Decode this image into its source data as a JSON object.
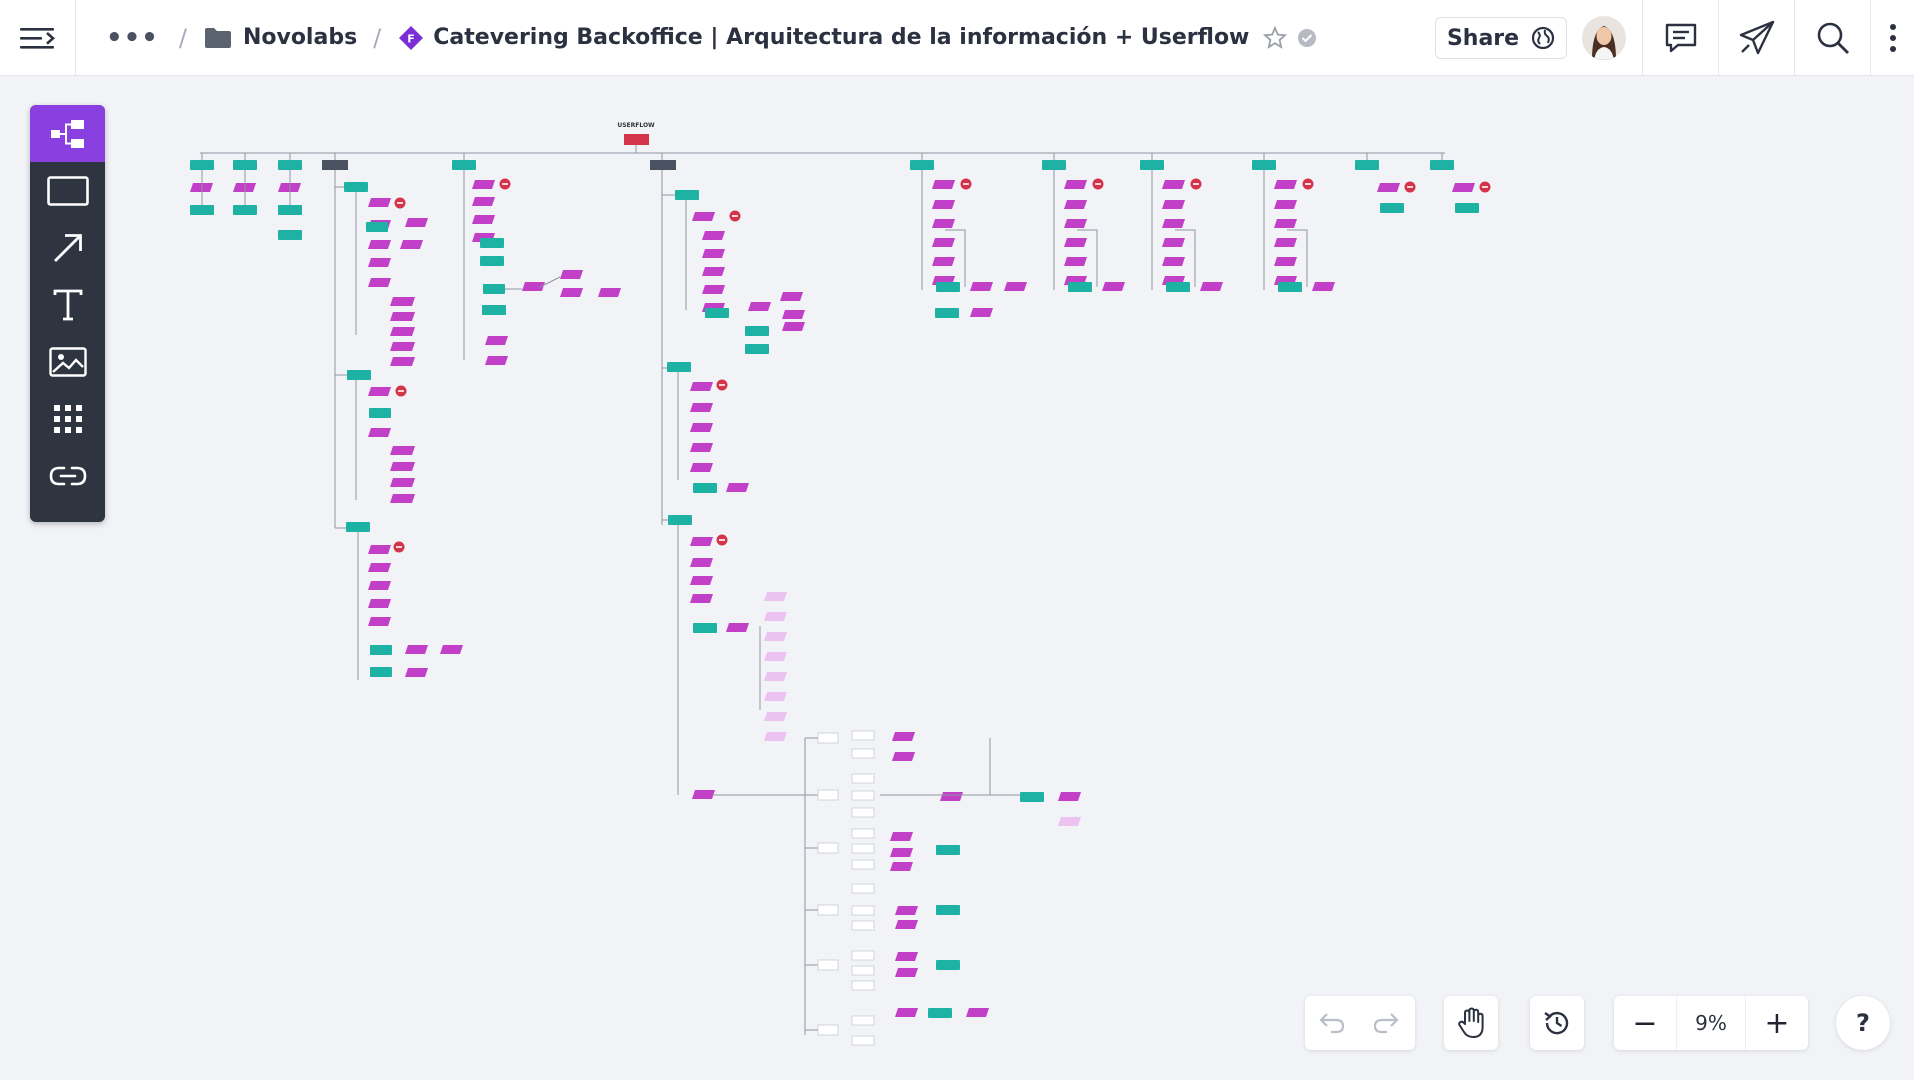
{
  "header": {
    "breadcrumb": {
      "more": "•••",
      "separator": "/",
      "folder": "Novolabs",
      "document_badge": "F",
      "document_title": "Catevering Backoffice | Arquitectura de la información + Userflow"
    },
    "share_label": "Share",
    "icons": [
      "menu-collapse-icon",
      "folder-icon",
      "file-badge-icon",
      "star-icon",
      "verified-icon",
      "globe-icon",
      "comment-icon",
      "send-icon",
      "search-icon",
      "more-vertical-icon"
    ]
  },
  "toolbar": {
    "tools": [
      {
        "name": "diagram-tool",
        "icon": "flowchart-icon",
        "active": true
      },
      {
        "name": "shape-tool",
        "icon": "rectangle-icon",
        "active": false
      },
      {
        "name": "arrow-tool",
        "icon": "arrow-icon",
        "active": false
      },
      {
        "name": "text-tool",
        "icon": "text-icon",
        "active": false
      },
      {
        "name": "image-tool",
        "icon": "image-icon",
        "active": false
      },
      {
        "name": "apps-tool",
        "icon": "grid-icon",
        "active": false
      },
      {
        "name": "link-tool",
        "icon": "link-icon",
        "active": false
      }
    ]
  },
  "canvas": {
    "root_title": "USERFLOW",
    "colors": {
      "teal": "#1db2a3",
      "magenta": "#c23fc7",
      "dark": "#4a5160",
      "red": "#d4344a",
      "light_purple": "#ecc2f0",
      "connector": "#8f95a0"
    }
  },
  "controls": {
    "zoom": "9%",
    "zoom_out": "−",
    "zoom_in": "+",
    "help": "?",
    "icons": [
      "undo-icon",
      "redo-icon",
      "hand-icon",
      "history-icon"
    ]
  },
  "accent_colors": {
    "brand_purple": "#8a3fe0",
    "toolbar_bg": "#2e3440"
  }
}
